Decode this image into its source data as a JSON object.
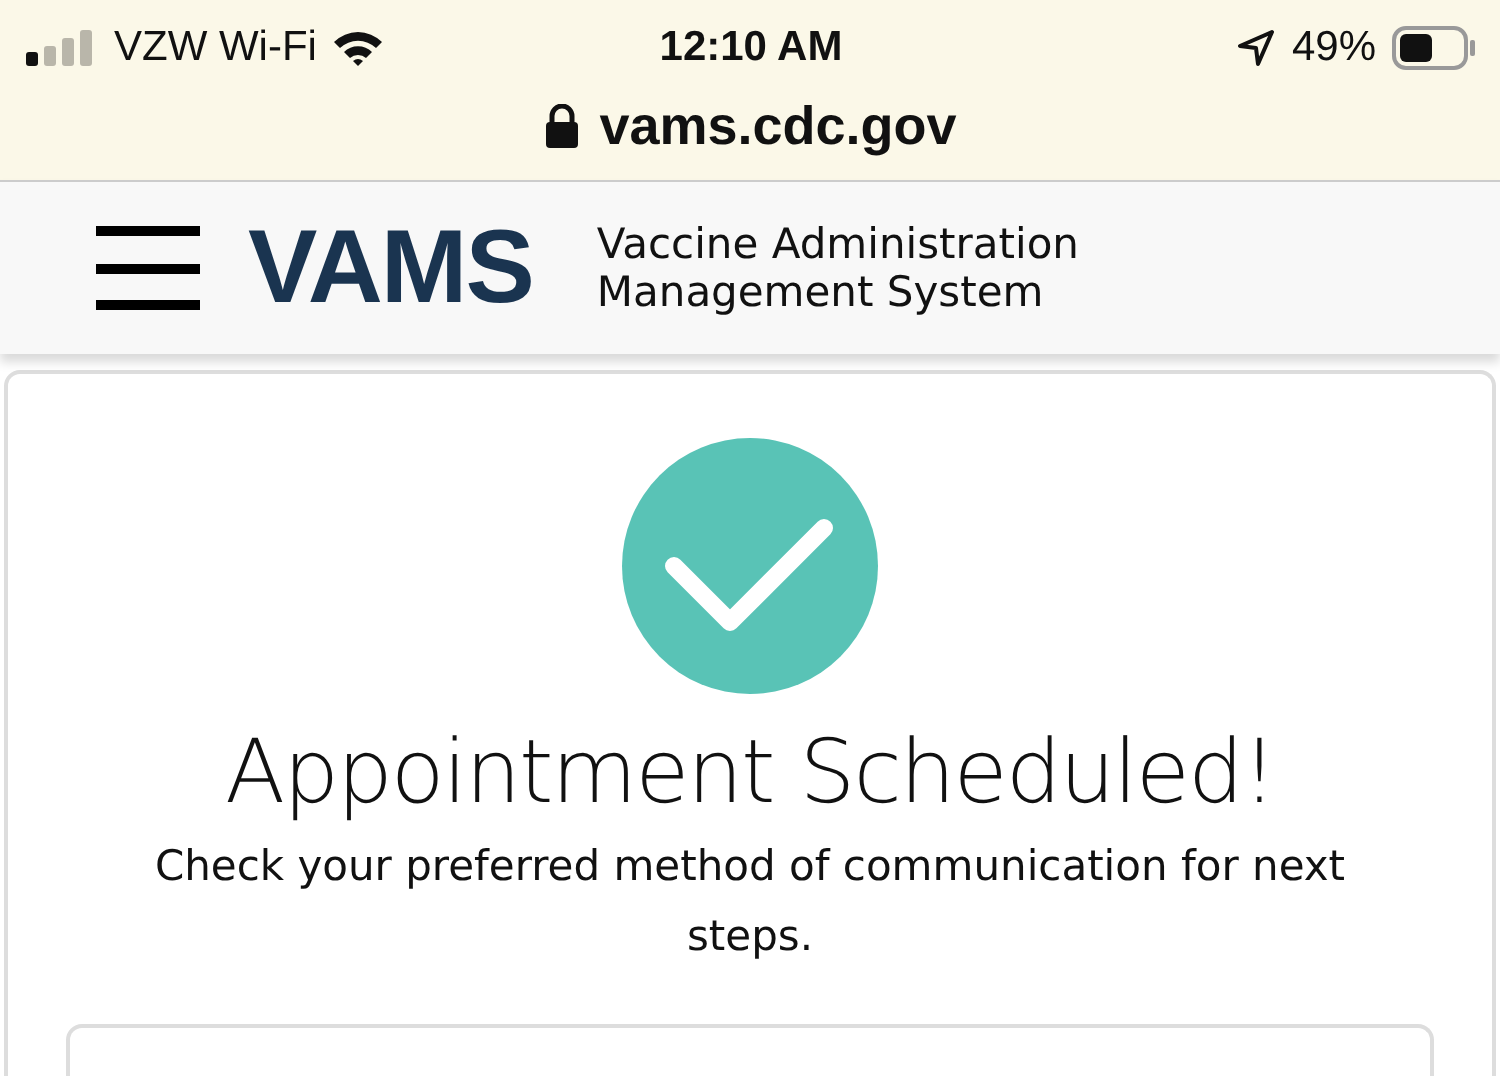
{
  "status_bar": {
    "carrier": "VZW Wi-Fi",
    "time": "12:10 AM",
    "battery": "49%"
  },
  "address_bar": {
    "url": "vams.cdc.gov"
  },
  "header": {
    "logo": "VAMS",
    "title_lines": [
      "Vaccine Administration",
      "Management System"
    ]
  },
  "confirmation": {
    "title": "Appointment Scheduled!",
    "message": "Check your preferred method of communication for next steps."
  }
}
